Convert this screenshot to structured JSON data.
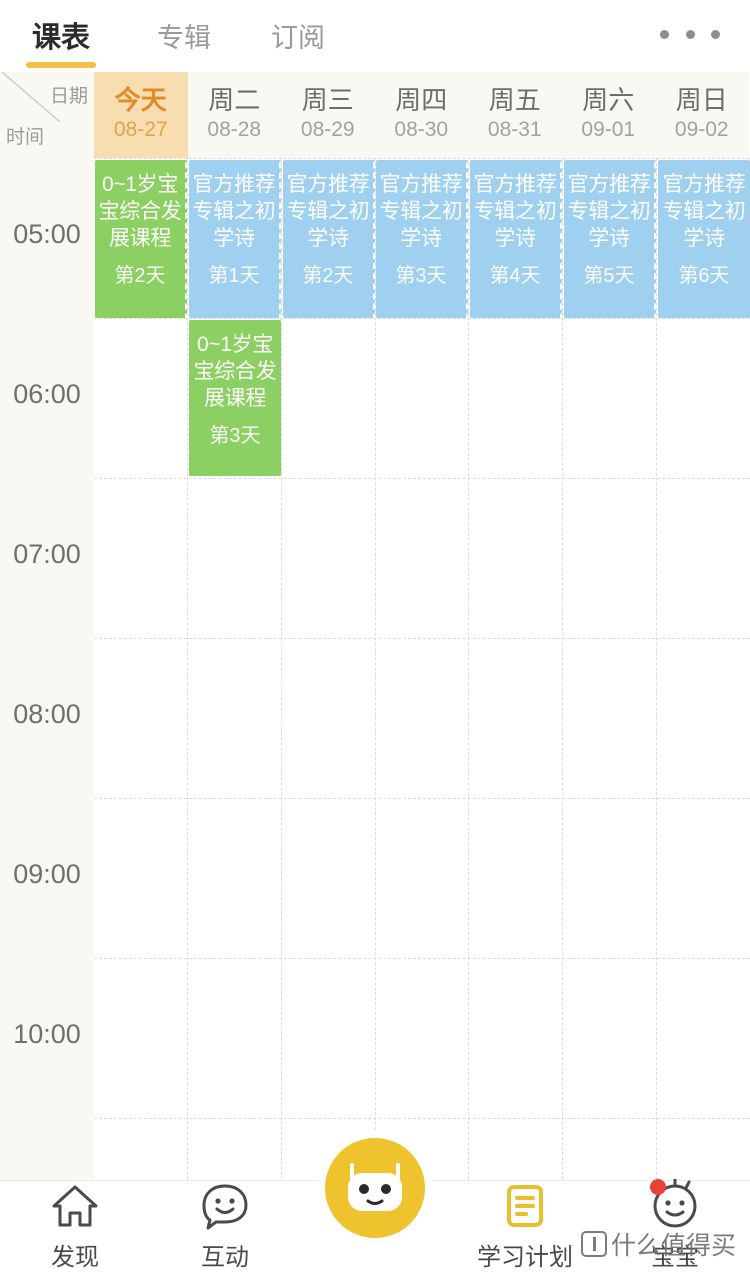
{
  "topbar": {
    "tabs": [
      {
        "label": "课表",
        "active": true
      },
      {
        "label": "专辑",
        "active": false
      },
      {
        "label": "订阅",
        "active": false
      }
    ],
    "more_icon": "more-horizontal-icon"
  },
  "schedule": {
    "corner": {
      "date_label": "日期",
      "time_label": "时间"
    },
    "days": [
      {
        "name": "今天",
        "date": "08-27",
        "today": true
      },
      {
        "name": "周二",
        "date": "08-28",
        "today": false
      },
      {
        "name": "周三",
        "date": "08-29",
        "today": false
      },
      {
        "name": "周四",
        "date": "08-30",
        "today": false
      },
      {
        "name": "周五",
        "date": "08-31",
        "today": false
      },
      {
        "name": "周六",
        "date": "09-01",
        "today": false
      },
      {
        "name": "周日",
        "date": "09-02",
        "today": false
      }
    ],
    "times": [
      "05:00",
      "06:00",
      "07:00",
      "08:00",
      "09:00",
      "10:00"
    ],
    "events": [
      {
        "col": 0,
        "row": 0,
        "title": "0~1岁宝宝综合发展课程",
        "day": "第2天",
        "color": "green",
        "hex": "#8ccf63"
      },
      {
        "col": 1,
        "row": 0,
        "title": "官方推荐专辑之初学诗",
        "day": "第1天",
        "color": "blue",
        "hex": "#9fd0ef"
      },
      {
        "col": 2,
        "row": 0,
        "title": "官方推荐专辑之初学诗",
        "day": "第2天",
        "color": "blue",
        "hex": "#9fd0ef"
      },
      {
        "col": 3,
        "row": 0,
        "title": "官方推荐专辑之初学诗",
        "day": "第3天",
        "color": "blue",
        "hex": "#9fd0ef"
      },
      {
        "col": 4,
        "row": 0,
        "title": "官方推荐专辑之初学诗",
        "day": "第4天",
        "color": "blue",
        "hex": "#9fd0ef"
      },
      {
        "col": 5,
        "row": 0,
        "title": "官方推荐专辑之初学诗",
        "day": "第5天",
        "color": "blue",
        "hex": "#9fd0ef"
      },
      {
        "col": 6,
        "row": 0,
        "title": "官方推荐专辑之初学诗",
        "day": "第6天",
        "color": "blue",
        "hex": "#9fd0ef"
      },
      {
        "col": 1,
        "row": 1,
        "title": "0~1岁宝宝综合发展课程",
        "day": "第3天",
        "color": "green",
        "hex": "#8ccf63"
      }
    ]
  },
  "bottom_nav": {
    "items": [
      {
        "label": "发现",
        "icon": "home-icon"
      },
      {
        "label": "互动",
        "icon": "smiley-icon"
      },
      {
        "label": "学习计划",
        "icon": "list-icon"
      },
      {
        "label": "宝宝",
        "icon": "baby-face-icon",
        "badge": true
      }
    ],
    "center": {
      "icon": "robot-icon"
    }
  },
  "watermark": {
    "text": "什么值得买"
  },
  "colors": {
    "accent": "#f5c043",
    "today_bg": "#f8ddb0",
    "today_text": "#e08b25",
    "green_event": "#8ccf63",
    "blue_event": "#9fd0ef",
    "side_bg": "#faf8f2",
    "center_button": "#efc32e",
    "badge": "#e8403a"
  }
}
